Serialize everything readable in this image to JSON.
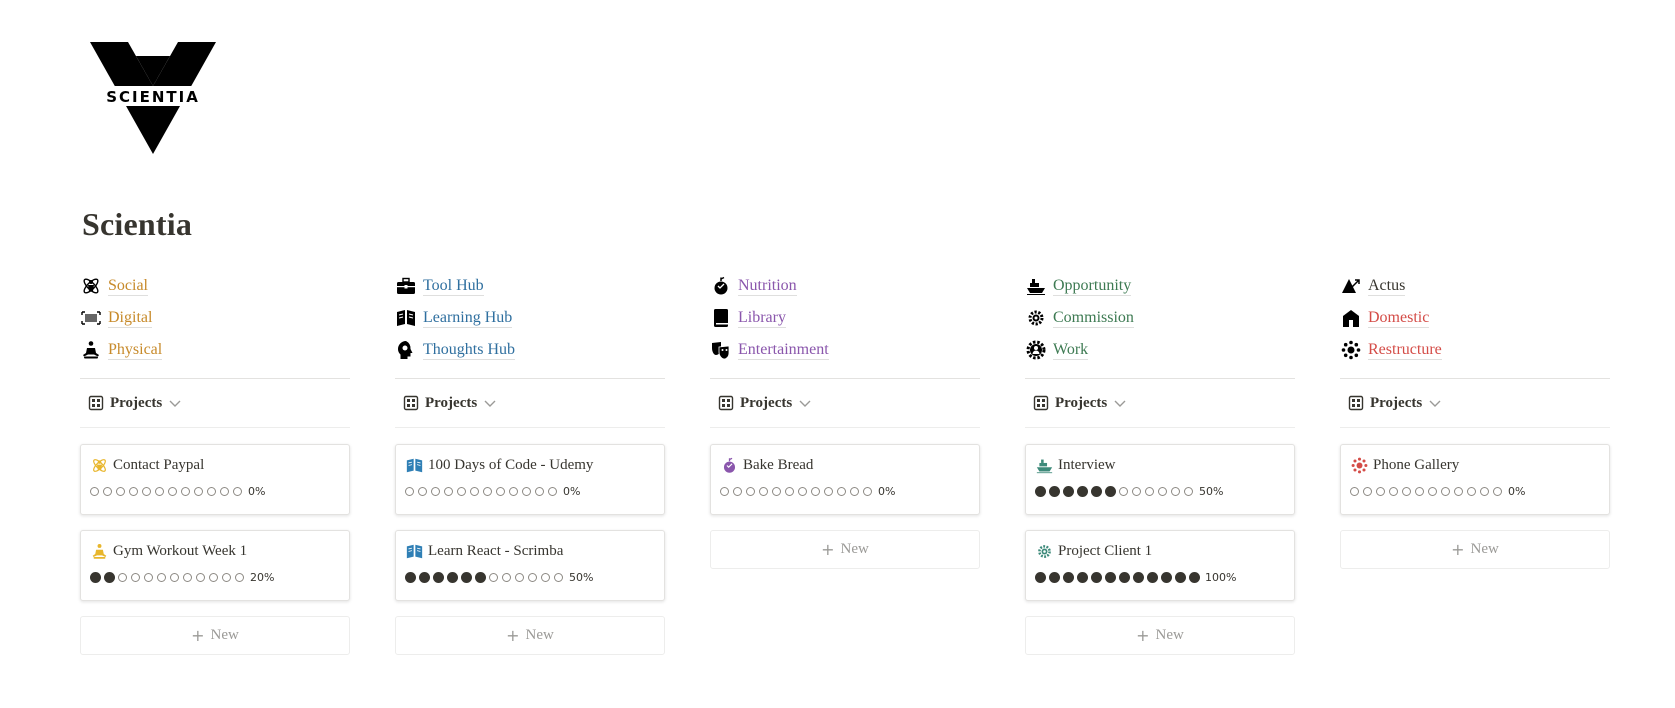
{
  "page": {
    "title": "Scientia",
    "logo_text": "SCIENTIA"
  },
  "colors": {
    "orange": "#c78a2a",
    "blue": "#2f6f9f",
    "purple": "#8a56ac",
    "green": "#3d7a52",
    "red": "#d44c47",
    "dark": "#37352f"
  },
  "columns": [
    {
      "links": [
        {
          "label": "Social",
          "icon": "atom-person-icon",
          "color": "#c78a2a"
        },
        {
          "label": "Digital",
          "icon": "barcode-icon",
          "color": "#c78a2a"
        },
        {
          "label": "Physical",
          "icon": "meditation-icon",
          "color": "#c78a2a"
        }
      ],
      "view": {
        "label": "Projects"
      },
      "cards": [
        {
          "title": "Contact Paypal",
          "icon": "atom-person-icon",
          "icon_color": "#e8b62c",
          "filled": 0,
          "total": 12,
          "percent": "0%"
        },
        {
          "title": "Gym Workout Week 1",
          "icon": "meditation-icon",
          "icon_color": "#e8b62c",
          "filled": 2,
          "total": 12,
          "percent": "20%"
        }
      ],
      "new_label": "New"
    },
    {
      "links": [
        {
          "label": "Tool Hub",
          "icon": "toolbox-icon",
          "color": "#2f6f9f"
        },
        {
          "label": "Learning Hub",
          "icon": "open-book-icon",
          "color": "#2f6f9f"
        },
        {
          "label": "Thoughts Hub",
          "icon": "head-idea-icon",
          "color": "#2f6f9f"
        }
      ],
      "view": {
        "label": "Projects"
      },
      "cards": [
        {
          "title": "100 Days of Code - Udemy",
          "icon": "open-book-icon",
          "icon_color": "#2f7fb5",
          "filled": 0,
          "total": 12,
          "percent": "0%"
        },
        {
          "title": "Learn React - Scrimba",
          "icon": "open-book-icon",
          "icon_color": "#2f7fb5",
          "filled": 6,
          "total": 12,
          "percent": "50%"
        }
      ],
      "new_label": "New"
    },
    {
      "links": [
        {
          "label": "Nutrition",
          "icon": "nutrition-icon",
          "color": "#8a56ac"
        },
        {
          "label": "Library",
          "icon": "book-icon",
          "color": "#8a56ac"
        },
        {
          "label": "Entertainment",
          "icon": "theater-masks-icon",
          "color": "#8a56ac"
        }
      ],
      "view": {
        "label": "Projects"
      },
      "cards": [
        {
          "title": "Bake Bread",
          "icon": "nutrition-icon",
          "icon_color": "#8a56ac",
          "filled": 0,
          "total": 12,
          "percent": "0%"
        }
      ],
      "new_label": "New"
    },
    {
      "links": [
        {
          "label": "Opportunity",
          "icon": "ship-icon",
          "color": "#3d7a52"
        },
        {
          "label": "Commission",
          "icon": "gear-cluster-icon",
          "color": "#3d7a52"
        },
        {
          "label": "Work",
          "icon": "gear-person-icon",
          "color": "#3d7a52"
        }
      ],
      "view": {
        "label": "Projects"
      },
      "cards": [
        {
          "title": "Interview",
          "icon": "ship-icon",
          "icon_color": "#3d8a7a",
          "filled": 6,
          "total": 12,
          "percent": "50%"
        },
        {
          "title": "Project Client 1",
          "icon": "gear-cluster-icon",
          "icon_color": "#3d8a7a",
          "filled": 12,
          "total": 12,
          "percent": "100%"
        }
      ],
      "new_label": "New"
    },
    {
      "links": [
        {
          "label": "Actus",
          "icon": "triangle-arrow-icon",
          "color": "#37352f"
        },
        {
          "label": "Domestic",
          "icon": "house-icon",
          "color": "#d44c47"
        },
        {
          "label": "Restructure",
          "icon": "sun-burst-icon",
          "color": "#d44c47"
        }
      ],
      "view": {
        "label": "Projects"
      },
      "cards": [
        {
          "title": "Phone Gallery",
          "icon": "sun-burst-icon",
          "icon_color": "#d44c47",
          "filled": 0,
          "total": 12,
          "percent": "0%"
        }
      ],
      "new_label": "New"
    }
  ]
}
